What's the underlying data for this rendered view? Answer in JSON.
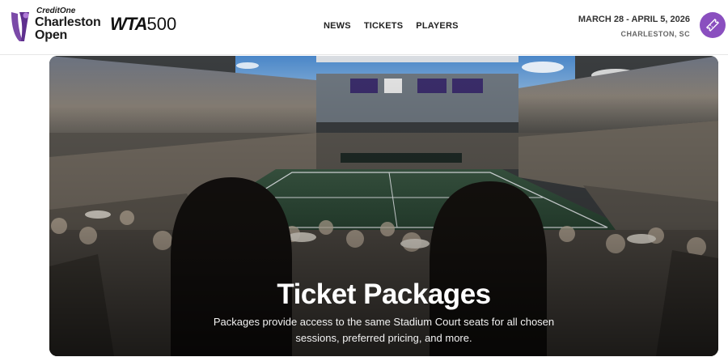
{
  "brand": {
    "sponsor": "CreditOne",
    "name_line1": "Charleston",
    "name_line2": "Open",
    "tour_word": "WTA",
    "tour_number": "500",
    "accent_color": "#8a4fbf"
  },
  "nav": {
    "items": [
      {
        "label": "NEWS"
      },
      {
        "label": "TICKETS"
      },
      {
        "label": "PLAYERS"
      }
    ]
  },
  "event": {
    "dates": "MARCH 28 - APRIL 5, 2026",
    "location": "CHARLESTON, SC",
    "ticket_icon": "ticket-icon"
  },
  "hero": {
    "title": "Ticket Packages",
    "description": "Packages provide access to the same Stadium Court seats for all chosen sessions, preferred pricing, and more."
  }
}
